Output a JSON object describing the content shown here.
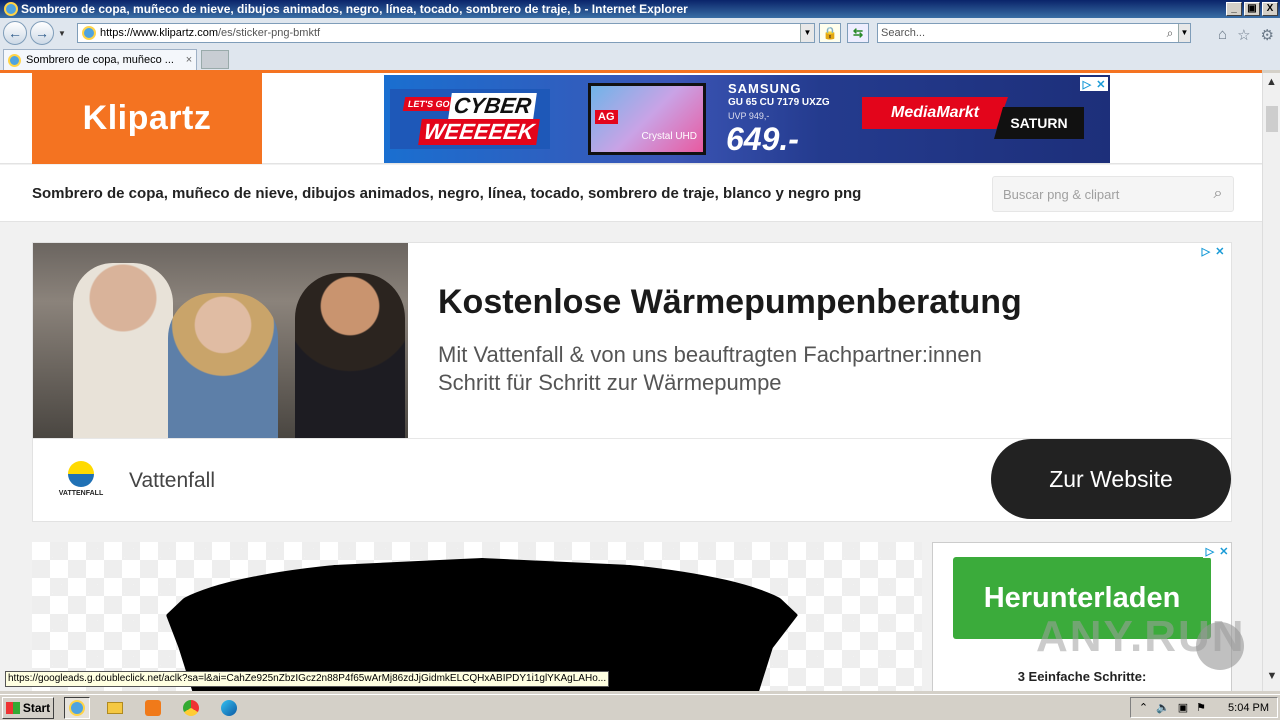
{
  "window": {
    "title": "Sombrero de copa, muñeco de nieve, dibujos animados, negro, línea, tocado, sombrero de traje, b - Internet Explorer",
    "min": "_",
    "max": "▣",
    "close": "X"
  },
  "nav": {
    "url_host": "https://www.klipartz.com",
    "url_path": "/es/sticker-png-bmktf",
    "search_placeholder": "Search..."
  },
  "tab": {
    "label": "Sombrero de copa, muñeco ...",
    "close": "×"
  },
  "site": {
    "logo": "Klipartz",
    "page_title": "Sombrero de copa, muñeco de nieve, dibujos animados, negro, línea, tocado, sombrero de traje, blanco y negro png",
    "search_placeholder": "Buscar png & clipart",
    "accent": "#f47321"
  },
  "top_ad": {
    "lets_go": "LET'S GO!",
    "cyber": "CYBER",
    "weeeek": "WEEEEEK",
    "brand": "SAMSUNG",
    "model": "GU 65 CU 7179 UXZG",
    "uvp": "UVP 949,-",
    "price": "649.-",
    "tv_text": "Crystal UHD",
    "tv_badge": "AG",
    "mediamarkt": "MediaMarkt",
    "saturn": "SATURN"
  },
  "main_ad": {
    "headline": "Kostenlose Wärmepumpenberatung",
    "description": "Mit Vattenfall & von uns beauftragten Fachpartner:innen Schritt für Schritt zur Wärmepumpe",
    "brand": "Vattenfall",
    "brand_logo_text": "VATTENFALL",
    "cta": "Zur Website"
  },
  "side_ad": {
    "button": "Herunterladen",
    "steps": "3 Eeinfache Schritte:"
  },
  "watermark": "ANY.RUN",
  "status_url": "https://googleads.g.doubleclick.net/aclk?sa=l&ai=CahZe925nZbzIGcz2n88P4f65wArMj86zdJjGidmkELCQHxABIPDY1i1glYKAgLAHo...",
  "taskbar": {
    "start": "Start",
    "time": "5:04 PM"
  }
}
